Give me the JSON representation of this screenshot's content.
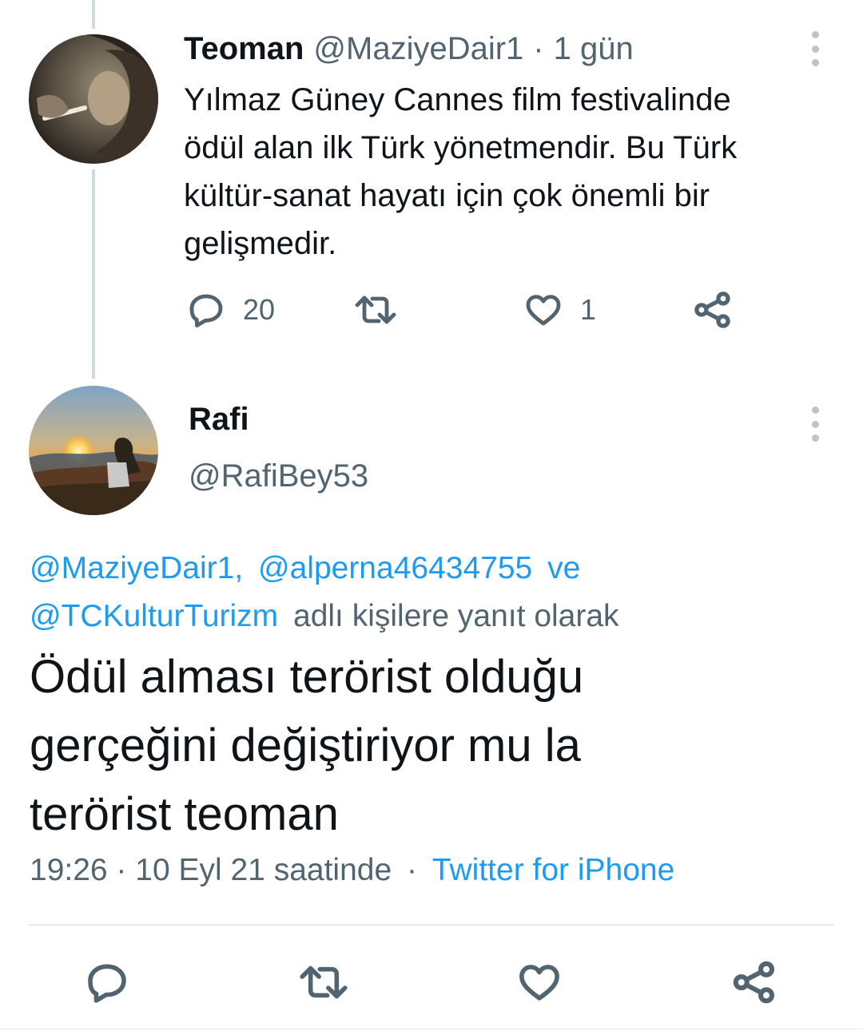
{
  "parent_tweet": {
    "display_name": "Teoman",
    "handle": "@MaziyeDair1",
    "separator": "·",
    "time": "1 gün",
    "text_lines": [
      "Yılmaz Güney Cannes film festivalinde",
      "ödül alan ilk Türk yönetmendir. Bu Türk",
      "kültür-sanat hayatı için çok önemli bir",
      "gelişmedir."
    ],
    "reply_count": "20",
    "retweet_count": "",
    "like_count": "1",
    "icons": [
      "reply-icon",
      "retweet-icon",
      "like-icon",
      "share-icon",
      "more-options-icon"
    ]
  },
  "main_tweet": {
    "display_name": "Rafi",
    "handle": "@RafiBey53",
    "reply_to": {
      "mention_1": "@MaziyeDair1,",
      "mention_2": "@alperna46434755",
      "conjunction": "ve",
      "mention_3": "@TCKulturTurizm",
      "suffix": "adlı kişilere yanıt olarak"
    },
    "text_lines": [
      "Ödül alması terörist olduğu",
      "gerçeğini değiştiriyor mu la",
      "terörist teoman"
    ],
    "timestamp": "19:26 · 10 Eyl 21 saatinde",
    "meta_separator": "·",
    "source": "Twitter for iPhone",
    "icons": [
      "reply-icon",
      "retweet-icon",
      "like-icon",
      "share-icon",
      "more-options-icon"
    ]
  },
  "colors": {
    "text": "#0f1419",
    "secondary_text": "#536471",
    "link": "#1d9bf0",
    "thread_line": "#cfd9de"
  }
}
